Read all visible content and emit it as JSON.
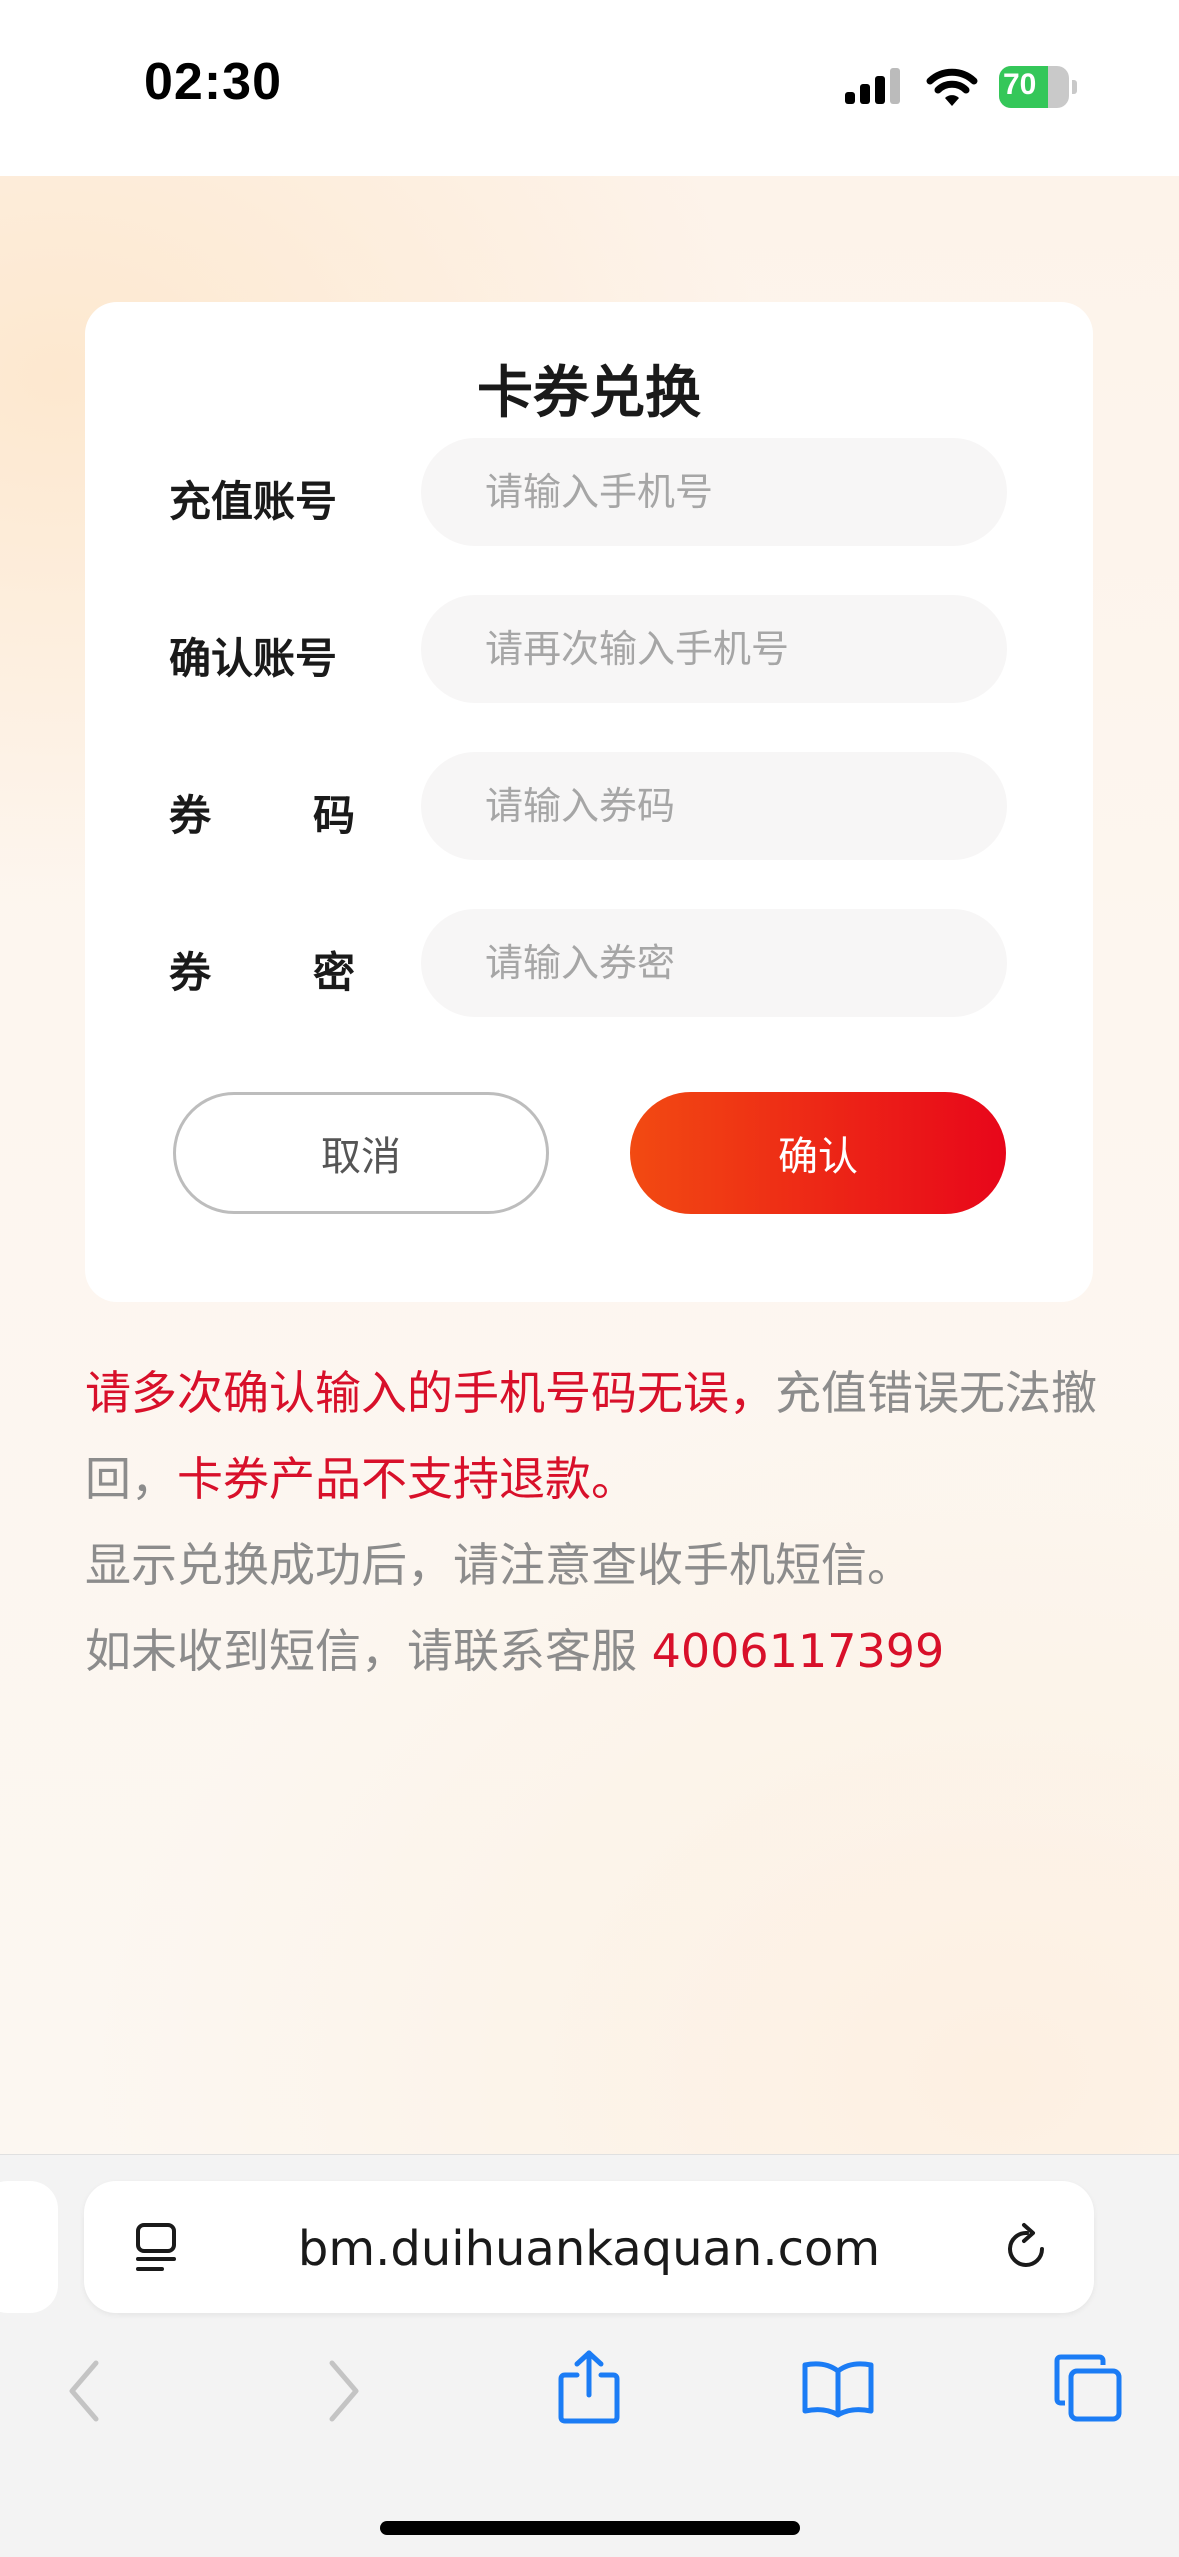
{
  "status_bar": {
    "time": "02:30",
    "battery": "70"
  },
  "card": {
    "title": "卡券兑换",
    "fields": [
      {
        "label": "充值账号",
        "placeholder": "请输入手机号"
      },
      {
        "label": "确认账号",
        "placeholder": "请再次输入手机号"
      },
      {
        "label_chars": [
          "券",
          "码"
        ],
        "placeholder": "请输入券码"
      },
      {
        "label_chars": [
          "券",
          "密"
        ],
        "placeholder": "请输入券密"
      }
    ],
    "cancel_label": "取消",
    "confirm_label": "确认"
  },
  "notice": {
    "red_1": "请多次确认输入的手机号码无误，",
    "gray_1": "充值错误无法撤回，",
    "red_2": "卡券产品不支持退款。",
    "line_3": "显示兑换成功后，请注意查收手机短信。",
    "line_4": "如未收到短信，请联系客服 ",
    "phone": "4006117399"
  },
  "browser": {
    "url": "bm.duihuankaquan.com",
    "icons": [
      "page-menu-icon",
      "reload-icon",
      "back-icon",
      "forward-icon",
      "share-icon",
      "bookmarks-icon",
      "tabs-icon"
    ]
  },
  "colors": {
    "accent_red": "#d8102a",
    "button_gradient_start": "#f24a12",
    "button_gradient_end": "#e8061a",
    "safari_blue": "#1b7cf5"
  }
}
